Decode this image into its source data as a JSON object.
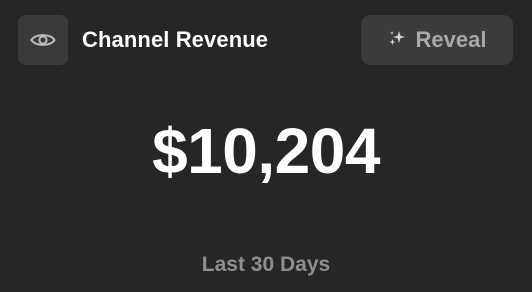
{
  "header": {
    "toggle_icon": "eye-icon",
    "title": "Channel Revenue",
    "reveal": {
      "icon": "sparkle-icon",
      "label": "Reveal"
    }
  },
  "metric": {
    "value": "$10,204",
    "period": "Last 30 Days"
  },
  "colors": {
    "background": "#262626",
    "button_bg": "#3b3b3b",
    "title_text": "#ffffff",
    "muted_text": "#8e8e8e"
  }
}
